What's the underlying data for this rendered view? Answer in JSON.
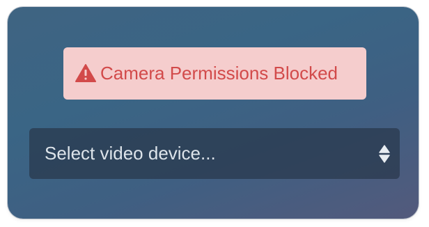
{
  "alert": {
    "icon": "warning-triangle-icon",
    "message": "Camera Permissions Blocked",
    "color": "#d24a4a",
    "background": "#f5cdcd"
  },
  "device_select": {
    "placeholder": "Select video device...",
    "icon": "sort-arrows-icon"
  }
}
